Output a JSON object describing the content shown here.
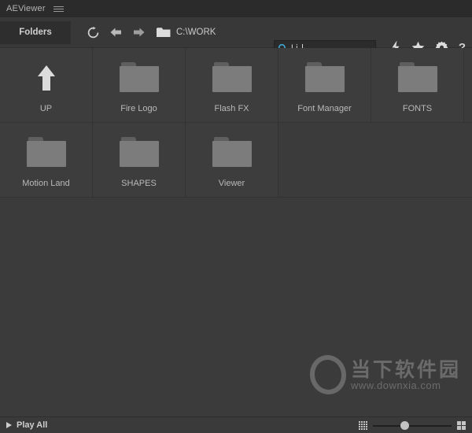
{
  "window": {
    "app_title": "AEViewer",
    "menu_icon": "hamburger-icon"
  },
  "toolbar": {
    "folders_tab_label": "Folders",
    "refresh_icon": "refresh-icon",
    "back_icon": "arrow-left-icon",
    "forward_icon": "arrow-right-icon",
    "folder_icon": "folder-icon",
    "path": "C:\\WORK",
    "search": {
      "icon": "search-icon",
      "value": "Li",
      "placeholder": ""
    },
    "actions": [
      {
        "name": "lightning-icon",
        "label": ""
      },
      {
        "name": "star-icon",
        "label": ""
      },
      {
        "name": "gear-icon",
        "label": ""
      },
      {
        "name": "help-icon",
        "label": "?"
      }
    ]
  },
  "content": {
    "rows": [
      {
        "tiles": [
          {
            "label": "UP",
            "icon": "up-arrow-icon"
          },
          {
            "label": "Fire Logo",
            "icon": "folder-icon"
          },
          {
            "label": "Flash FX",
            "icon": "folder-icon"
          },
          {
            "label": "Font Manager",
            "icon": "folder-icon"
          },
          {
            "label": "FONTS",
            "icon": "folder-icon"
          }
        ]
      },
      {
        "tiles": [
          {
            "label": "Motion Land",
            "icon": "folder-icon"
          },
          {
            "label": "SHAPES",
            "icon": "folder-icon"
          },
          {
            "label": "Viewer",
            "icon": "folder-icon"
          }
        ]
      }
    ]
  },
  "watermark": {
    "logo": "downxia-ring-logo",
    "chinese": "当下软件园",
    "url": "www.downxia.com"
  },
  "statusbar": {
    "play_all_label": "Play All",
    "play_icon": "play-triangle-icon",
    "thumb_small_icon": "grid-small-icon",
    "thumb_large_icon": "grid-large-icon",
    "zoom_slider": {
      "name": "thumbnail-size-slider",
      "value": 35,
      "min": 0,
      "max": 100
    }
  },
  "colors": {
    "window_bg": "#3b3b3b",
    "titlebar_bg": "#2b2b2b",
    "toolbar_bg": "#383838",
    "tile_bg": "#3d3d3d",
    "folder_fill": "#7c7c7c",
    "text": "#b9b9b9",
    "accent_search": "#3fa9d6"
  }
}
